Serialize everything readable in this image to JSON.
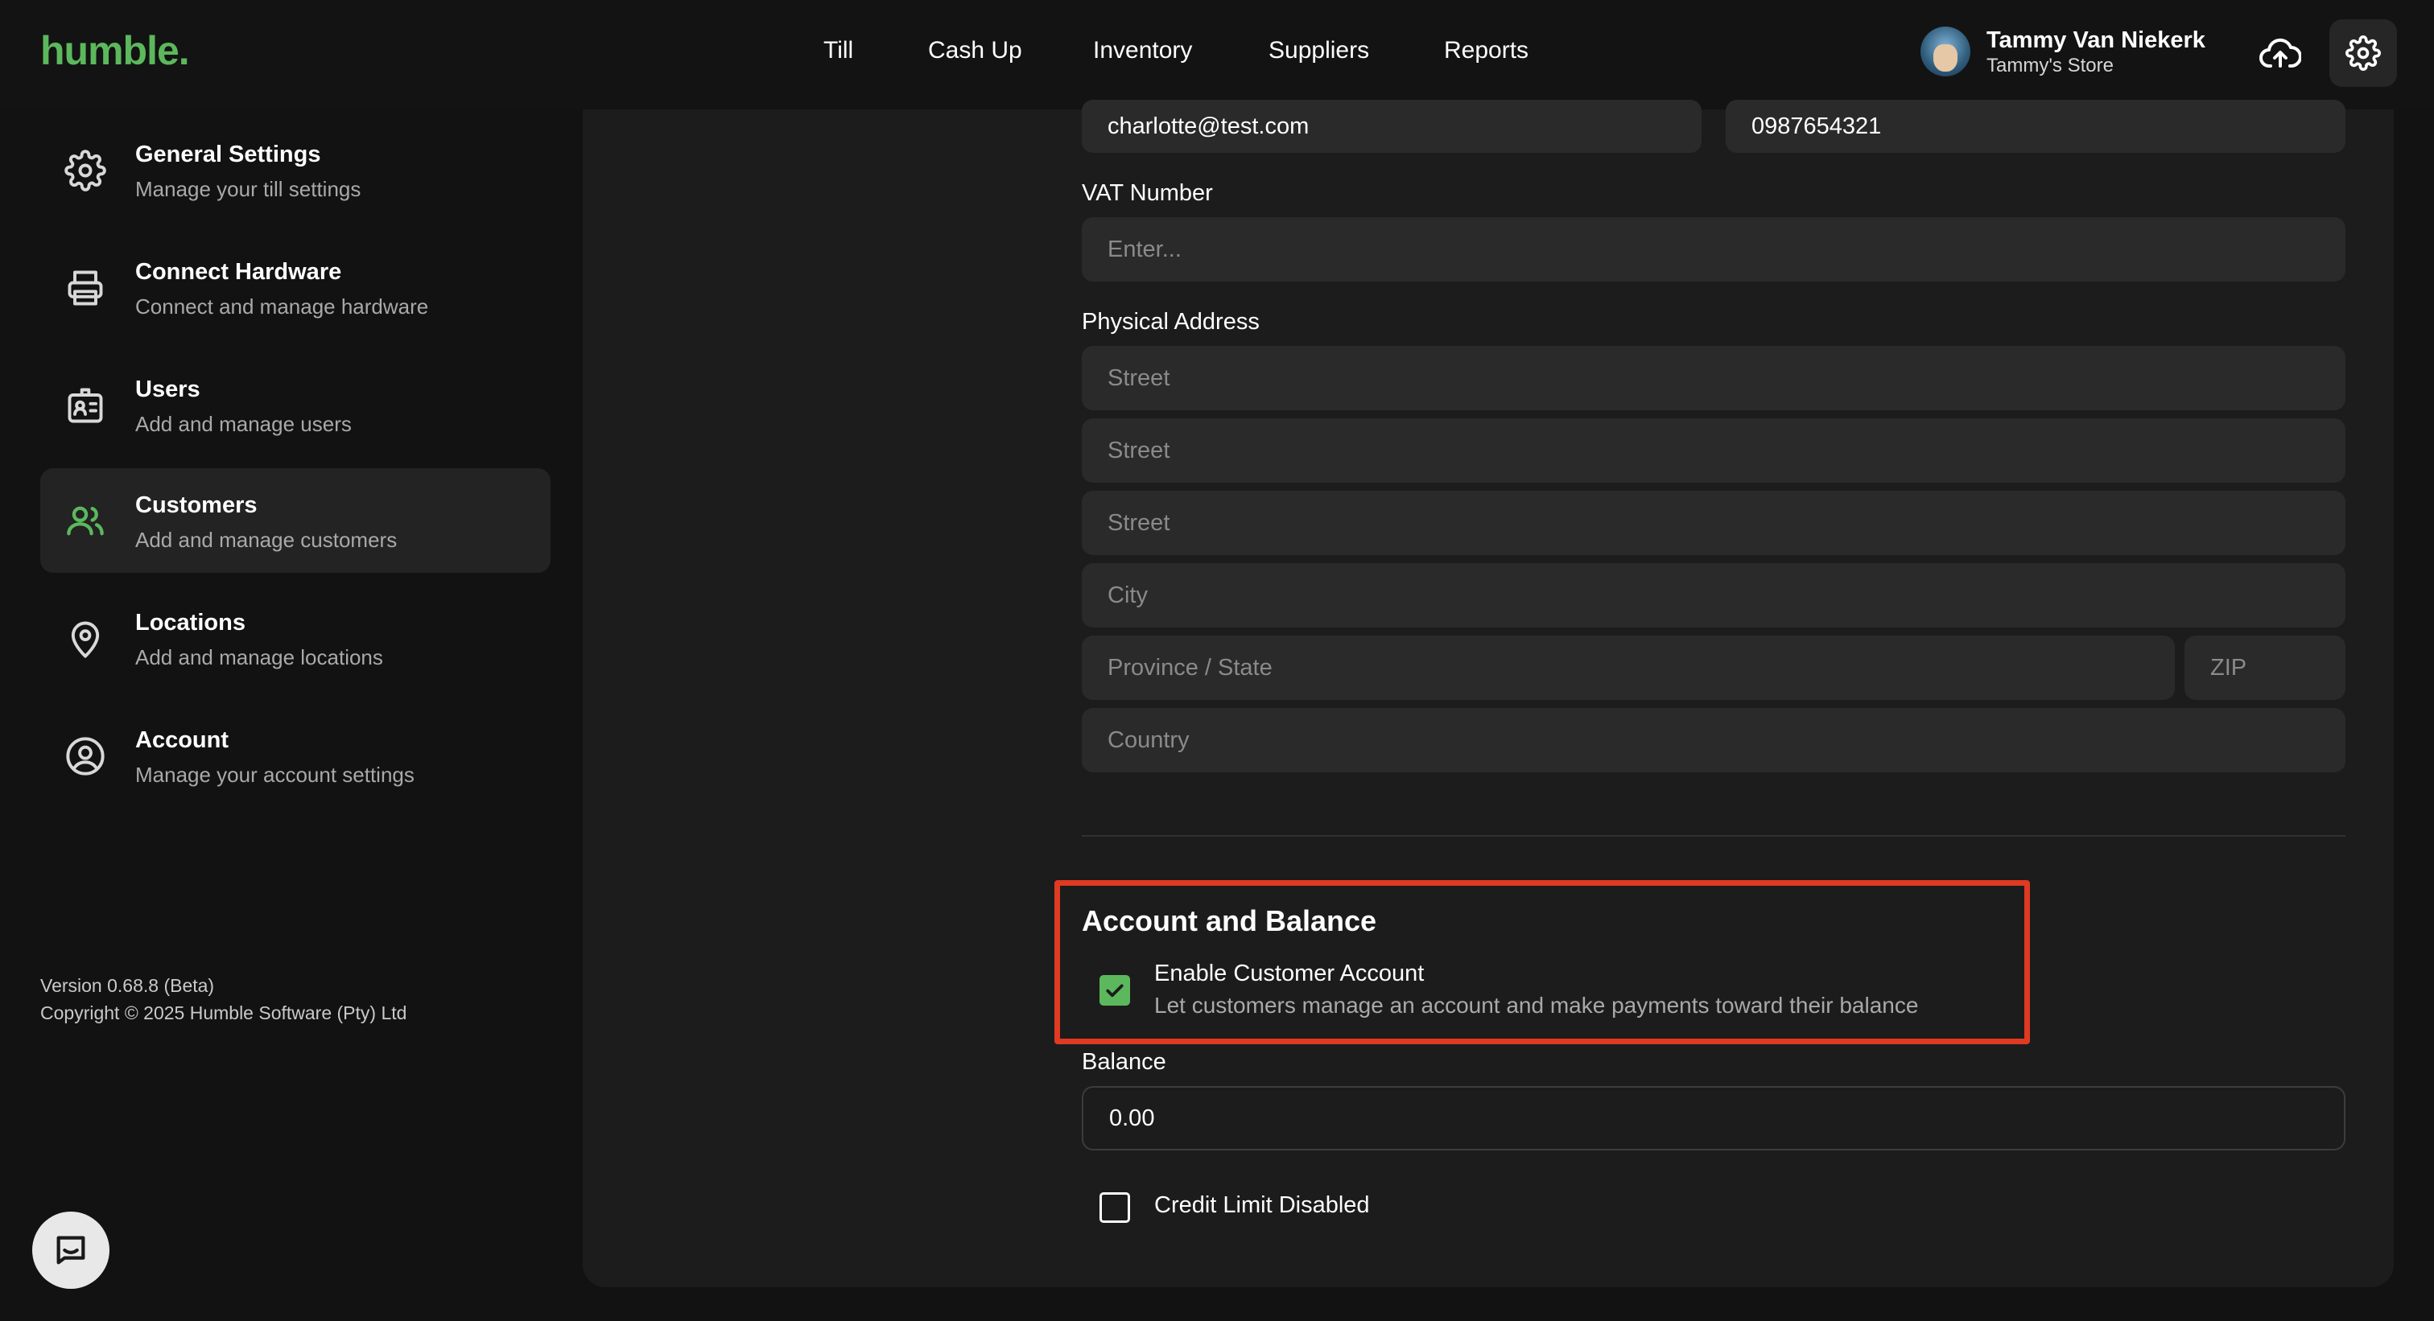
{
  "header": {
    "logo": "humble.",
    "nav": [
      "Till",
      "Cash Up",
      "Inventory",
      "Suppliers",
      "Reports"
    ],
    "user_name": "Tammy Van Niekerk",
    "user_store": "Tammy's Store"
  },
  "sidebar": {
    "items": [
      {
        "title": "General Settings",
        "subtitle": "Manage your till settings",
        "icon": "gear-icon"
      },
      {
        "title": "Connect Hardware",
        "subtitle": "Connect and manage hardware",
        "icon": "printer-icon"
      },
      {
        "title": "Users",
        "subtitle": "Add and manage users",
        "icon": "id-badge-icon"
      },
      {
        "title": "Customers",
        "subtitle": "Add and manage customers",
        "icon": "people-icon",
        "active": true
      },
      {
        "title": "Locations",
        "subtitle": "Add and manage locations",
        "icon": "location-pin-icon"
      },
      {
        "title": "Account",
        "subtitle": "Manage your account settings",
        "icon": "user-circle-icon"
      }
    ],
    "version": "Version 0.68.8 (Beta)",
    "copyright": "Copyright © 2025 Humble Software (Pty) Ltd"
  },
  "form": {
    "email_value": "charlotte@test.com",
    "phone_value": "0987654321",
    "vat_label": "VAT Number",
    "vat_placeholder": "Enter...",
    "address_label": "Physical Address",
    "street1_placeholder": "Street",
    "street2_placeholder": "Street",
    "street3_placeholder": "Street",
    "city_placeholder": "City",
    "province_placeholder": "Province / State",
    "zip_placeholder": "ZIP",
    "country_placeholder": "Country",
    "section_title": "Account and Balance",
    "enable_account_label": "Enable Customer Account",
    "enable_account_desc": "Let customers manage an account and make payments toward their balance",
    "enable_account_checked": true,
    "balance_label": "Balance",
    "balance_value": "0.00",
    "credit_limit_label": "Credit Limit Disabled",
    "credit_limit_checked": false
  },
  "colors": {
    "brand": "#5cb85c",
    "highlight": "#e03a22",
    "background": "#121212",
    "panel": "#1c1c1c"
  }
}
